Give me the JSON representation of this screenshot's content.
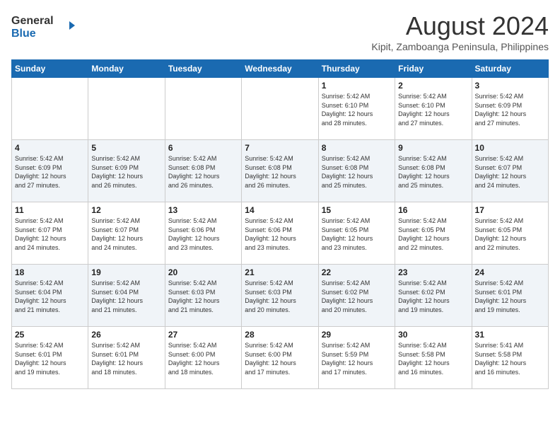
{
  "header": {
    "logo_line1": "General",
    "logo_line2": "Blue",
    "title": "August 2024",
    "subtitle": "Kipit, Zamboanga Peninsula, Philippines"
  },
  "weekdays": [
    "Sunday",
    "Monday",
    "Tuesday",
    "Wednesday",
    "Thursday",
    "Friday",
    "Saturday"
  ],
  "weeks": [
    [
      {
        "day": "",
        "info": ""
      },
      {
        "day": "",
        "info": ""
      },
      {
        "day": "",
        "info": ""
      },
      {
        "day": "",
        "info": ""
      },
      {
        "day": "1",
        "info": "Sunrise: 5:42 AM\nSunset: 6:10 PM\nDaylight: 12 hours\nand 28 minutes."
      },
      {
        "day": "2",
        "info": "Sunrise: 5:42 AM\nSunset: 6:10 PM\nDaylight: 12 hours\nand 27 minutes."
      },
      {
        "day": "3",
        "info": "Sunrise: 5:42 AM\nSunset: 6:09 PM\nDaylight: 12 hours\nand 27 minutes."
      }
    ],
    [
      {
        "day": "4",
        "info": "Sunrise: 5:42 AM\nSunset: 6:09 PM\nDaylight: 12 hours\nand 27 minutes."
      },
      {
        "day": "5",
        "info": "Sunrise: 5:42 AM\nSunset: 6:09 PM\nDaylight: 12 hours\nand 26 minutes."
      },
      {
        "day": "6",
        "info": "Sunrise: 5:42 AM\nSunset: 6:08 PM\nDaylight: 12 hours\nand 26 minutes."
      },
      {
        "day": "7",
        "info": "Sunrise: 5:42 AM\nSunset: 6:08 PM\nDaylight: 12 hours\nand 26 minutes."
      },
      {
        "day": "8",
        "info": "Sunrise: 5:42 AM\nSunset: 6:08 PM\nDaylight: 12 hours\nand 25 minutes."
      },
      {
        "day": "9",
        "info": "Sunrise: 5:42 AM\nSunset: 6:08 PM\nDaylight: 12 hours\nand 25 minutes."
      },
      {
        "day": "10",
        "info": "Sunrise: 5:42 AM\nSunset: 6:07 PM\nDaylight: 12 hours\nand 24 minutes."
      }
    ],
    [
      {
        "day": "11",
        "info": "Sunrise: 5:42 AM\nSunset: 6:07 PM\nDaylight: 12 hours\nand 24 minutes."
      },
      {
        "day": "12",
        "info": "Sunrise: 5:42 AM\nSunset: 6:07 PM\nDaylight: 12 hours\nand 24 minutes."
      },
      {
        "day": "13",
        "info": "Sunrise: 5:42 AM\nSunset: 6:06 PM\nDaylight: 12 hours\nand 23 minutes."
      },
      {
        "day": "14",
        "info": "Sunrise: 5:42 AM\nSunset: 6:06 PM\nDaylight: 12 hours\nand 23 minutes."
      },
      {
        "day": "15",
        "info": "Sunrise: 5:42 AM\nSunset: 6:05 PM\nDaylight: 12 hours\nand 23 minutes."
      },
      {
        "day": "16",
        "info": "Sunrise: 5:42 AM\nSunset: 6:05 PM\nDaylight: 12 hours\nand 22 minutes."
      },
      {
        "day": "17",
        "info": "Sunrise: 5:42 AM\nSunset: 6:05 PM\nDaylight: 12 hours\nand 22 minutes."
      }
    ],
    [
      {
        "day": "18",
        "info": "Sunrise: 5:42 AM\nSunset: 6:04 PM\nDaylight: 12 hours\nand 21 minutes."
      },
      {
        "day": "19",
        "info": "Sunrise: 5:42 AM\nSunset: 6:04 PM\nDaylight: 12 hours\nand 21 minutes."
      },
      {
        "day": "20",
        "info": "Sunrise: 5:42 AM\nSunset: 6:03 PM\nDaylight: 12 hours\nand 21 minutes."
      },
      {
        "day": "21",
        "info": "Sunrise: 5:42 AM\nSunset: 6:03 PM\nDaylight: 12 hours\nand 20 minutes."
      },
      {
        "day": "22",
        "info": "Sunrise: 5:42 AM\nSunset: 6:02 PM\nDaylight: 12 hours\nand 20 minutes."
      },
      {
        "day": "23",
        "info": "Sunrise: 5:42 AM\nSunset: 6:02 PM\nDaylight: 12 hours\nand 19 minutes."
      },
      {
        "day": "24",
        "info": "Sunrise: 5:42 AM\nSunset: 6:01 PM\nDaylight: 12 hours\nand 19 minutes."
      }
    ],
    [
      {
        "day": "25",
        "info": "Sunrise: 5:42 AM\nSunset: 6:01 PM\nDaylight: 12 hours\nand 19 minutes."
      },
      {
        "day": "26",
        "info": "Sunrise: 5:42 AM\nSunset: 6:01 PM\nDaylight: 12 hours\nand 18 minutes."
      },
      {
        "day": "27",
        "info": "Sunrise: 5:42 AM\nSunset: 6:00 PM\nDaylight: 12 hours\nand 18 minutes."
      },
      {
        "day": "28",
        "info": "Sunrise: 5:42 AM\nSunset: 6:00 PM\nDaylight: 12 hours\nand 17 minutes."
      },
      {
        "day": "29",
        "info": "Sunrise: 5:42 AM\nSunset: 5:59 PM\nDaylight: 12 hours\nand 17 minutes."
      },
      {
        "day": "30",
        "info": "Sunrise: 5:42 AM\nSunset: 5:58 PM\nDaylight: 12 hours\nand 16 minutes."
      },
      {
        "day": "31",
        "info": "Sunrise: 5:41 AM\nSunset: 5:58 PM\nDaylight: 12 hours\nand 16 minutes."
      }
    ]
  ]
}
